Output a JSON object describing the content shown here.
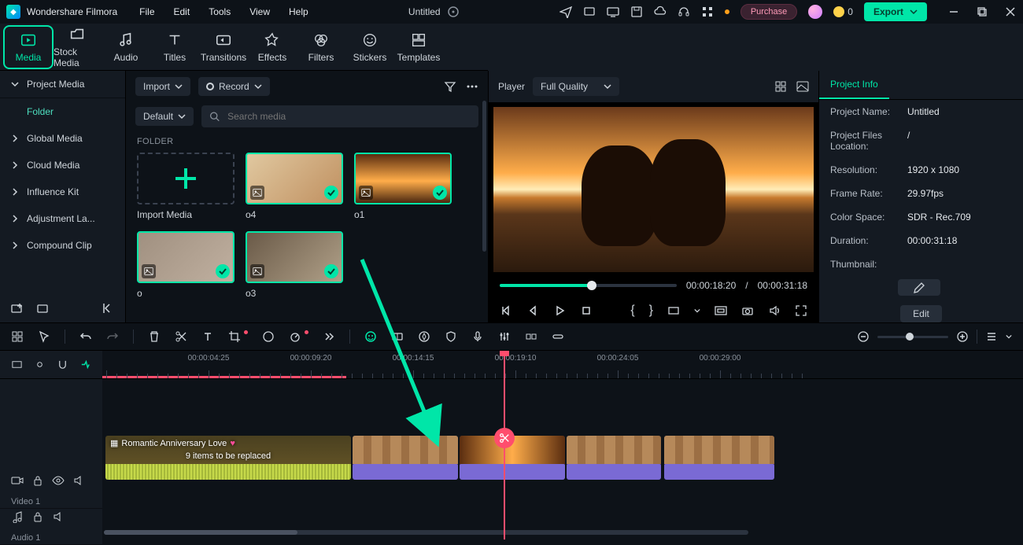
{
  "app": {
    "name": "Wondershare Filmora"
  },
  "menu": [
    "File",
    "Edit",
    "Tools",
    "View",
    "Help"
  ],
  "doc_title": "Untitled",
  "purchase": "Purchase",
  "coin": "0",
  "export": "Export",
  "tabs": [
    {
      "id": "media",
      "label": "Media"
    },
    {
      "id": "stock",
      "label": "Stock Media"
    },
    {
      "id": "audio",
      "label": "Audio"
    },
    {
      "id": "titles",
      "label": "Titles"
    },
    {
      "id": "transitions",
      "label": "Transitions"
    },
    {
      "id": "effects",
      "label": "Effects"
    },
    {
      "id": "filters",
      "label": "Filters"
    },
    {
      "id": "stickers",
      "label": "Stickers"
    },
    {
      "id": "templates",
      "label": "Templates"
    }
  ],
  "sidebar": {
    "head": "Project Media",
    "folder": "Folder",
    "items": [
      "Global Media",
      "Cloud Media",
      "Influence Kit",
      "Adjustment La...",
      "Compound Clip"
    ]
  },
  "media": {
    "import": "Import",
    "record": "Record",
    "default": "Default",
    "search_ph": "Search media",
    "folder_lbl": "FOLDER",
    "import_media": "Import Media",
    "thumbs": [
      "o4",
      "o1",
      "o",
      "o3"
    ]
  },
  "player": {
    "label": "Player",
    "quality": "Full Quality",
    "current": "00:00:18:20",
    "sep": "/",
    "total": "00:00:31:18"
  },
  "info": {
    "tab": "Project Info",
    "rows": [
      {
        "k": "Project Name:",
        "v": "Untitled"
      },
      {
        "k": "Project Files Location:",
        "v": "/"
      },
      {
        "k": "Resolution:",
        "v": "1920 x 1080"
      },
      {
        "k": "Frame Rate:",
        "v": "29.97fps"
      },
      {
        "k": "Color Space:",
        "v": "SDR - Rec.709"
      },
      {
        "k": "Duration:",
        "v": "00:00:31:18"
      },
      {
        "k": "Thumbnail:",
        "v": ""
      }
    ],
    "edit": "Edit"
  },
  "ruler": [
    "00:00:04:25",
    "00:00:09:20",
    "00:00:14:15",
    "00:00:19:10",
    "00:00:24:05",
    "00:00:29:00"
  ],
  "tracks": {
    "video": "Video 1",
    "audio": "Audio 1"
  },
  "clip": {
    "title": "Romantic Anniversary Love",
    "sub": "9 items to be replaced"
  }
}
